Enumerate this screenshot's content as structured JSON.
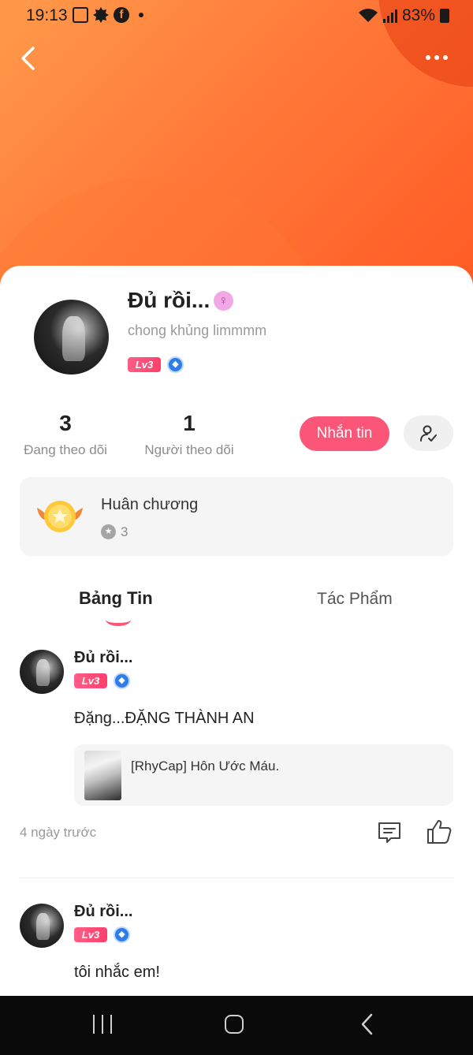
{
  "status_bar": {
    "time": "19:13",
    "battery": "83%",
    "icons": [
      "gallery-icon",
      "cog-icon",
      "facebook-icon",
      "dot-icon",
      "wifi-icon",
      "signal-icon",
      "battery-icon"
    ]
  },
  "header": {
    "back_icon": "chevron-left-icon",
    "more_icon": "more-dots-icon",
    "gradient_colors": [
      "#ff9a4a",
      "#ff5a24"
    ]
  },
  "profile": {
    "name": "Đủ rồi...",
    "gender_icon": "♀",
    "bio": "chong khủng limmmm",
    "level": "Lv3",
    "vip_icon": "vip-diamond-icon"
  },
  "stats": {
    "following_count": "3",
    "following_label": "Đang theo dõi",
    "followers_count": "1",
    "followers_label": "Người theo dõi"
  },
  "actions": {
    "message_label": "Nhắn tin",
    "follow_icon": "user-check-icon",
    "accent_color": "#fb5677"
  },
  "medals": {
    "title": "Huân chương",
    "count": "3",
    "medal_icon": "winged-medal-icon",
    "count_icon": "star-circle-icon"
  },
  "tabs": {
    "feed": "Bảng Tin",
    "works": "Tác Phẩm"
  },
  "posts": [
    {
      "author": "Đủ rồi...",
      "level": "Lv3",
      "text": "Đặng...ĐẶNG THÀNH AN",
      "link_title": "[RhyCap] Hôn Ước Máu.",
      "time": "4 ngày trước"
    },
    {
      "author": "Đủ rồi...",
      "level": "Lv3",
      "text": "tôi nhắc em!"
    }
  ],
  "nav_bar": {
    "icons": [
      "recent-apps-icon",
      "home-icon",
      "back-icon"
    ]
  }
}
